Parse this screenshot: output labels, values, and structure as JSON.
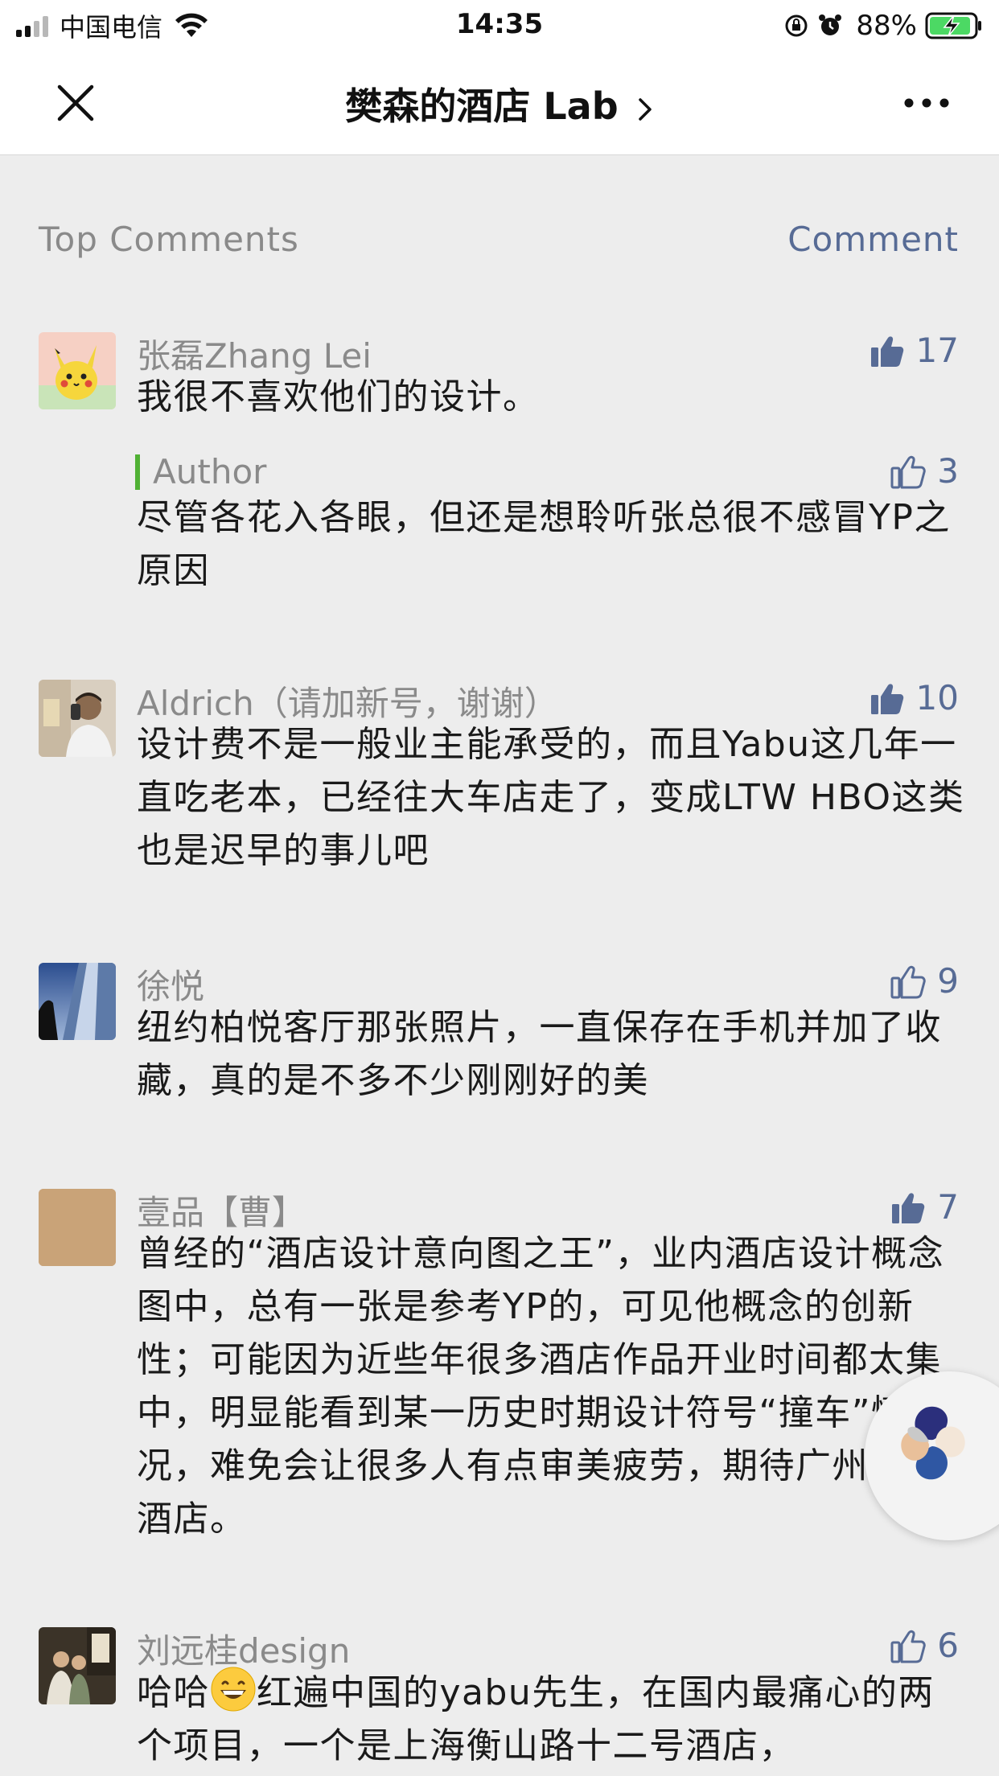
{
  "status_bar": {
    "carrier": "中国电信",
    "time": "14:35",
    "battery_percent": "88%"
  },
  "nav": {
    "title": "樊森的酒店 Lab",
    "close_icon": "close-icon",
    "more_icon": "more-icon"
  },
  "section": {
    "label": "Top Comments",
    "comment_link": "Comment"
  },
  "comments": [
    {
      "name": "张磊Zhang Lei",
      "likes": "17",
      "liked": true,
      "text": "我很不喜欢他们的设计。",
      "reply": {
        "label": "Author",
        "likes": "3",
        "liked": false,
        "text": "尽管各花入各眼，但还是想聆听张总很不感冒YP之原因"
      }
    },
    {
      "name": "Aldrich（请加新号，谢谢）",
      "likes": "10",
      "liked": true,
      "text": "设计费不是一般业主能承受的，而且Yabu这几年一直吃老本，已经往大车店走了，变成LTW HBO这类也是迟早的事儿吧"
    },
    {
      "name": "徐悦",
      "likes": "9",
      "liked": false,
      "text": "纽约柏悦客厅那张照片，一直保存在手机并加了收藏，真的是不多不少刚刚好的美"
    },
    {
      "name": "壹品【曹】",
      "likes": "7",
      "liked": true,
      "text": "曾经的“酒店设计意向图之王”，业内酒店设计概念图中，总有一张是参考YP的，可见他概念的创新性；可能因为近些年很多酒店作品开业时间都太集中，明显能看到某一历史时期设计符号“撞车”情况，难免会让很多人有点审美疲劳，期待广州瑰丽酒店。"
    },
    {
      "name": "刘远桂design",
      "likes": "6",
      "liked": false,
      "text_before_emoji": "哈哈",
      "text_after_emoji": "红遍中国的yabu先生，在国内最痛心的两个项目，一个是上海衡山路十二号酒店，"
    }
  ],
  "colors": {
    "accent_link": "#576b95",
    "name_gray": "#8a8a8a",
    "author_bar": "#50b134",
    "background": "#ededed"
  }
}
